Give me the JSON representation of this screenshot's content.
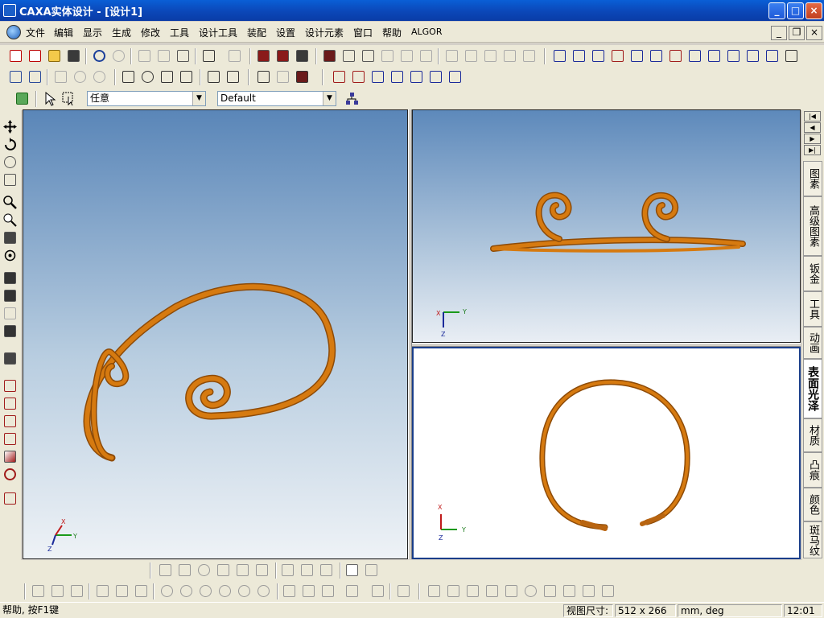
{
  "window": {
    "title": "CAXA实体设计 - [设计1]",
    "min_label": "_",
    "max_label": "□",
    "close_label": "×"
  },
  "menubar": {
    "items": [
      "文件",
      "编辑",
      "显示",
      "生成",
      "修改",
      "工具",
      "设计工具",
      "装配",
      "设置",
      "设计元素",
      "窗口",
      "帮助",
      "ALGOR"
    ],
    "mdi_min": "_",
    "mdi_restore": "❐",
    "mdi_close": "×"
  },
  "toolbar3": {
    "filter_value": "任意",
    "style_value": "Default"
  },
  "right_tabs": {
    "items": [
      "图素",
      "高级图素",
      "钣金",
      "工具",
      "动画",
      "表面光泽",
      "材质",
      "凸痕",
      "颜色",
      "斑马纹"
    ],
    "active": "表面光泽"
  },
  "axes": {
    "x": "X",
    "y": "Y",
    "z": "Z"
  },
  "colors": {
    "model": "#d67a10",
    "model_dark": "#9a5208",
    "viewport_top": "#5a86b8",
    "titlebar": "#0b47b8"
  },
  "statusbar": {
    "help": "帮助, 按F1键",
    "view_size_label": "视图尺寸:",
    "view_size_value": "512 x 266",
    "units": "mm, deg",
    "time": "12:01"
  }
}
